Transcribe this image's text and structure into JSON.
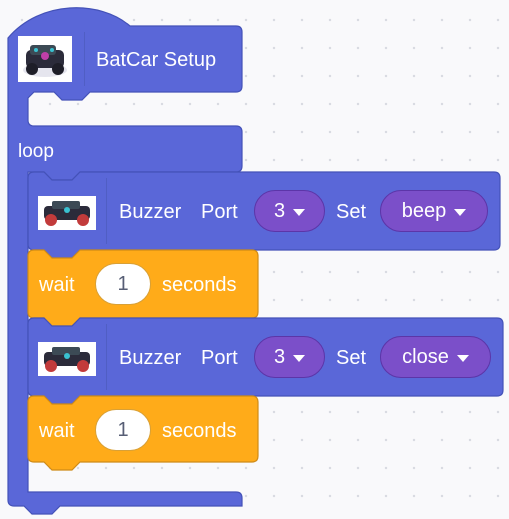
{
  "hat": {
    "label": "BatCar Setup",
    "image_icon": "robot-car-icon"
  },
  "loop": {
    "label": "loop"
  },
  "statements": [
    {
      "type": "buzzer",
      "label": "Buzzer",
      "port_label": "Port",
      "port_value": "3",
      "set_label": "Set",
      "set_value": "beep"
    },
    {
      "type": "wait",
      "label": "wait",
      "value": "1",
      "unit": "seconds"
    },
    {
      "type": "buzzer",
      "label": "Buzzer",
      "port_label": "Port",
      "port_value": "3",
      "set_label": "Set",
      "set_value": "close"
    },
    {
      "type": "wait",
      "label": "wait",
      "value": "1",
      "unit": "seconds"
    }
  ],
  "colors": {
    "block": "#5a67d8",
    "block_border": "#4452b8",
    "wait": "#ffab19",
    "wait_border": "#cf8b17",
    "dropdown": "#7b4fc9",
    "canvas": "#f9f9fb"
  }
}
